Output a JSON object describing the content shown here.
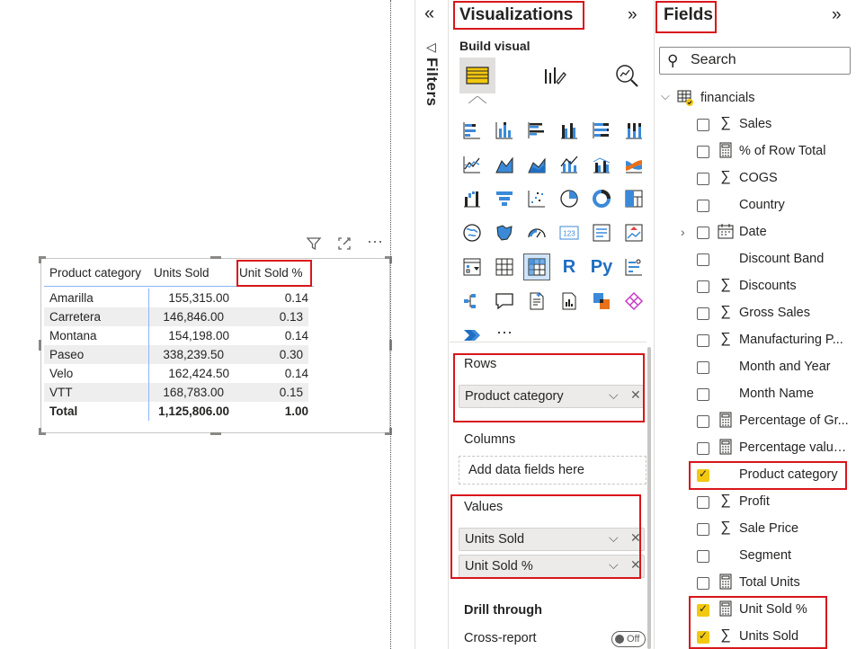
{
  "matrix": {
    "headers": [
      "Product category",
      "Units Sold",
      "Unit Sold %"
    ],
    "rows": [
      {
        "category": "Amarilla",
        "units": "155,315.00",
        "pct": "0.14"
      },
      {
        "category": "Carretera",
        "units": "146,846.00",
        "pct": "0.13"
      },
      {
        "category": "Montana",
        "units": "154,198.00",
        "pct": "0.14"
      },
      {
        "category": "Paseo",
        "units": "338,239.50",
        "pct": "0.30"
      },
      {
        "category": "Velo",
        "units": "162,424.50",
        "pct": "0.14"
      },
      {
        "category": "VTT",
        "units": "168,783.00",
        "pct": "0.15"
      }
    ],
    "total": {
      "category": "Total",
      "units": "1,125,806.00",
      "pct": "1.00"
    }
  },
  "visual_header": {
    "icons": [
      "filter-icon",
      "focus-mode-icon",
      "more-options-icon"
    ],
    "more": "···"
  },
  "filters": {
    "label": "Filters",
    "collapse": "«",
    "icon": "◁"
  },
  "visualizations": {
    "title": "Visualizations",
    "expand": "»",
    "build_visual": "Build visual",
    "more": "···",
    "custom_labels": {
      "r": "R",
      "py": "Py",
      "card": "123"
    },
    "wells": {
      "rows": {
        "label": "Rows",
        "fields": [
          "Product category"
        ]
      },
      "columns": {
        "label": "Columns",
        "placeholder": "Add data fields here"
      },
      "values": {
        "label": "Values",
        "fields": [
          "Units Sold",
          "Unit Sold %"
        ]
      }
    },
    "drill_through": "Drill through",
    "cross_report": {
      "label": "Cross-report",
      "state": "Off"
    }
  },
  "fields": {
    "title": "Fields",
    "expand": "»",
    "search_placeholder": "Search",
    "table": "financials",
    "items": [
      {
        "name": "Sales",
        "type": "sigma",
        "checked": false
      },
      {
        "name": "% of Row Total",
        "type": "calc",
        "checked": false
      },
      {
        "name": "COGS",
        "type": "sigma",
        "checked": false
      },
      {
        "name": "Country",
        "type": "",
        "checked": false
      },
      {
        "name": "Date",
        "type": "calendar",
        "checked": false,
        "expandable": true
      },
      {
        "name": "Discount Band",
        "type": "",
        "checked": false
      },
      {
        "name": "Discounts",
        "type": "sigma",
        "checked": false
      },
      {
        "name": "Gross Sales",
        "type": "sigma",
        "checked": false
      },
      {
        "name": "Manufacturing P...",
        "type": "sigma",
        "checked": false
      },
      {
        "name": "Month and Year",
        "type": "",
        "checked": false
      },
      {
        "name": "Month Name",
        "type": "",
        "checked": false
      },
      {
        "name": "Percentage of Gr...",
        "type": "calc",
        "checked": false
      },
      {
        "name": "Percentage value...",
        "type": "calc",
        "checked": false
      },
      {
        "name": "Product category",
        "type": "",
        "checked": true
      },
      {
        "name": "Profit",
        "type": "sigma",
        "checked": false
      },
      {
        "name": "Sale Price",
        "type": "sigma",
        "checked": false
      },
      {
        "name": "Segment",
        "type": "",
        "checked": false
      },
      {
        "name": "Total Units",
        "type": "calc",
        "checked": false
      },
      {
        "name": "Unit Sold %",
        "type": "calc",
        "checked": true
      },
      {
        "name": "Units Sold",
        "type": "sigma",
        "checked": true
      }
    ]
  },
  "colors": {
    "highlight": "#d8161b",
    "accent": "#f2c811",
    "selected_bg": "#cfe4fa",
    "row_alt": "#eeeeee"
  }
}
